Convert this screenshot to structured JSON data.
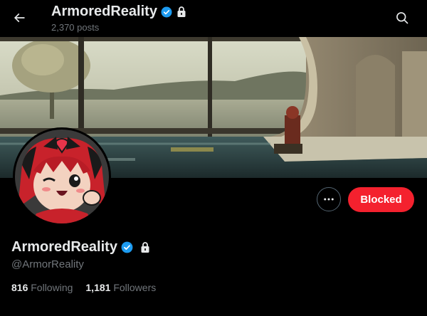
{
  "header": {
    "title": "ArmoredReality",
    "posts_count": "2,370 posts",
    "back_icon": "arrow-left-icon",
    "search_icon": "search-icon"
  },
  "profile": {
    "display_name": "ArmoredReality",
    "handle": "@ArmorReality",
    "verified_icon": "verified-badge-icon",
    "protected_icon": "lock-icon",
    "following_count": "816",
    "following_label": "Following",
    "followers_count": "1,181",
    "followers_label": "Followers"
  },
  "actions": {
    "more_icon": "more-horizontal-icon",
    "blocked_label": "Blocked"
  },
  "colors": {
    "background": "#000000",
    "verified_blue": "#1d9bf0",
    "blocked_red": "#f4212e",
    "secondary_text": "#71767b"
  }
}
